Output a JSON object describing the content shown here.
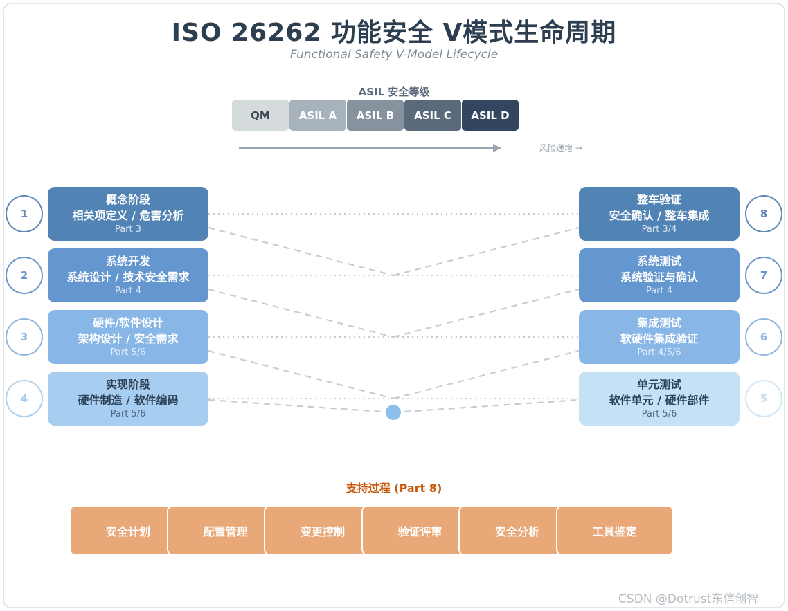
{
  "title": "ISO 26262 功能安全 V模式生命周期",
  "subtitle": "Functional Safety V-Model Lifecycle",
  "asil": {
    "title": "ASIL 安全等级",
    "levels": [
      {
        "label": "QM",
        "bg": "#d5dadd",
        "fg": "#3a4856"
      },
      {
        "label": "ASIL A",
        "bg": "#a7b2bd",
        "fg": "#ffffff"
      },
      {
        "label": "ASIL B",
        "bg": "#86929e",
        "fg": "#ffffff"
      },
      {
        "label": "ASIL C",
        "bg": "#5b6a7a",
        "fg": "#ffffff"
      },
      {
        "label": "ASIL D",
        "bg": "#324660",
        "fg": "#ffffff"
      }
    ],
    "risk_label": "风险递增 →"
  },
  "left_phases": [
    {
      "num": "1",
      "line1": "概念阶段",
      "line2": "相关项定义 / 危害分析",
      "part": "Part 3",
      "bg": "#5283b5",
      "fg": "#ffffff",
      "sub": "#d6e3f1",
      "ring": "#5f88b8",
      "numColor": "#5f88b8"
    },
    {
      "num": "2",
      "line1": "系统开发",
      "line2": "系统设计 / 技术安全需求",
      "part": "Part 4",
      "bg": "#6496cf",
      "fg": "#ffffff",
      "sub": "#dbe7f5",
      "ring": "#6a96c9",
      "numColor": "#6a96c9"
    },
    {
      "num": "3",
      "line1": "硬件/软件设计",
      "line2": "架构设计 / 安全需求",
      "part": "Part 5/6",
      "bg": "#88b6e6",
      "fg": "#ffffff",
      "sub": "#e4effa",
      "ring": "#8fb5de",
      "numColor": "#8fb5de"
    },
    {
      "num": "4",
      "line1": "实现阶段",
      "line2": "硬件制造 / 软件编码",
      "part": "Part 5/6",
      "bg": "#a7cdf0",
      "fg": "#2b3f55",
      "sub": "#51677f",
      "ring": "#aed0ee",
      "numColor": "#a9cbec"
    }
  ],
  "right_phases": [
    {
      "num": "8",
      "line1": "整车验证",
      "line2": "安全确认 / 整车集成",
      "part": "Part 3/4",
      "bg": "#5283b5",
      "fg": "#ffffff",
      "sub": "#d6e3f1",
      "ring": "#5f88b8",
      "numColor": "#5f88b8"
    },
    {
      "num": "7",
      "line1": "系统测试",
      "line2": "系统验证与确认",
      "part": "Part 4",
      "bg": "#6496cf",
      "fg": "#ffffff",
      "sub": "#dbe7f5",
      "ring": "#6a96c9",
      "numColor": "#6a96c9"
    },
    {
      "num": "6",
      "line1": "集成测试",
      "line2": "软硬件集成验证",
      "part": "Part 4/5/6",
      "bg": "#88b6e6",
      "fg": "#ffffff",
      "sub": "#e4effa",
      "ring": "#8fb5de",
      "numColor": "#8fb5de"
    },
    {
      "num": "5",
      "line1": "单元测试",
      "line2": "软件单元 / 硬件部件",
      "part": "Part 5/6",
      "bg": "#c4e1f5",
      "fg": "#2b3f55",
      "sub": "#51677f",
      "ring": "#cfe6f6",
      "numColor": "#c2dff3"
    }
  ],
  "support": {
    "title": "支持过程 (Part 8)",
    "items": [
      "安全计划",
      "配置管理",
      "变更控制",
      "验证评审",
      "安全分析",
      "工具鉴定"
    ]
  },
  "watermark": "CSDN @Dotrust东信创智"
}
